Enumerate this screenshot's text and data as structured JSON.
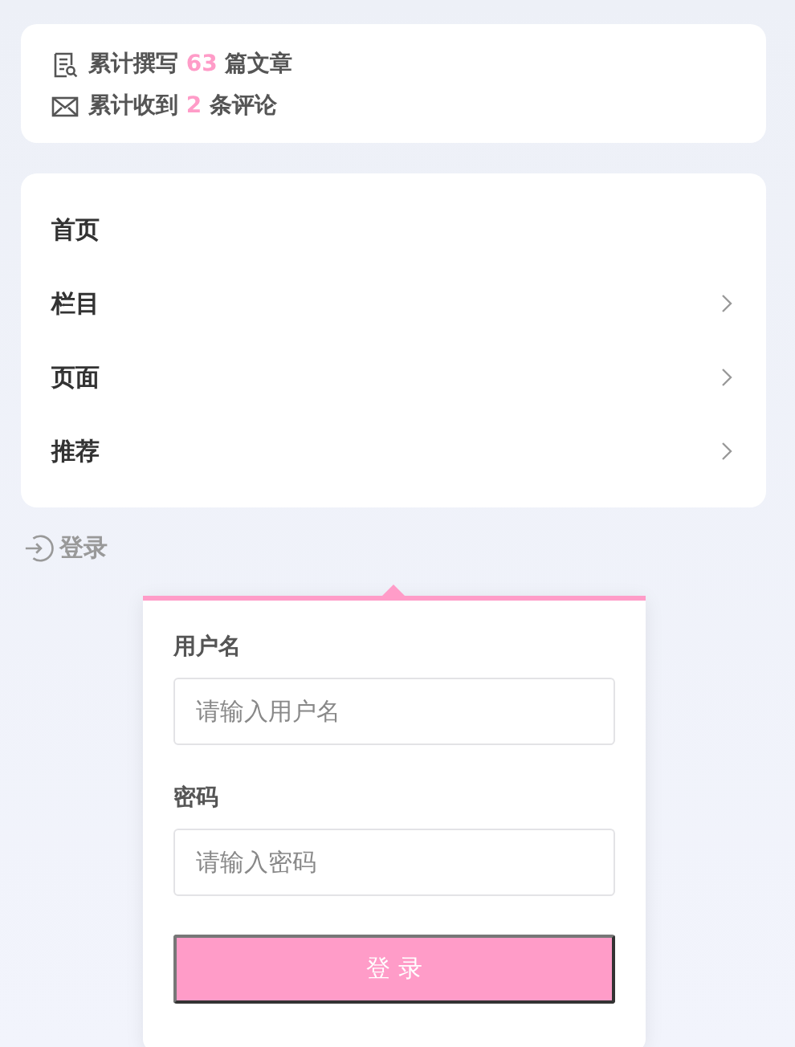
{
  "stats": [
    {
      "kind": "articles",
      "prefix": "累计撰写",
      "count": "63",
      "suffix": "篇文章"
    },
    {
      "kind": "comments",
      "prefix": "累计收到",
      "count": "2",
      "suffix": "条评论"
    }
  ],
  "nav": [
    {
      "label": "首页",
      "has_submenu": false
    },
    {
      "label": "栏目",
      "has_submenu": true
    },
    {
      "label": "页面",
      "has_submenu": true
    },
    {
      "label": "推荐",
      "has_submenu": true
    }
  ],
  "login_link": "登录",
  "login_form": {
    "fields": [
      {
        "label": "用户名",
        "placeholder": "请输入用户名"
      },
      {
        "label": "密码",
        "placeholder": "请输入密码"
      }
    ],
    "submit": "登 录"
  }
}
